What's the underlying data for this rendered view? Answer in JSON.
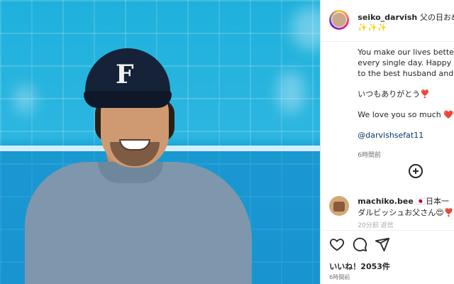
{
  "post": {
    "username": "seiko_darvish",
    "title_tail": "父の日おめ",
    "sparkles": "✨✨✨",
    "caption_lines": [
      "You make our lives better i",
      "every single day. Happy Fa",
      "to the best husband and fa"
    ],
    "thanks": "いつもありがとう❣️",
    "love": "We love you so much ❤️❤️",
    "mention": "@darvishsefat11",
    "time": "6時間前"
  },
  "cap_letter": "F",
  "comment": {
    "username": "machiko.bee",
    "text_line1": "🇯🇵日本一",
    "text_line2": "ダルビッシュお父さん😍❣️",
    "meta": "20分前 返信"
  },
  "actions": {
    "likes": "いいね！2053件",
    "ago": "6時間前"
  },
  "icons": [
    "heart-icon",
    "comment-icon",
    "share-icon",
    "add-comment-icon"
  ]
}
